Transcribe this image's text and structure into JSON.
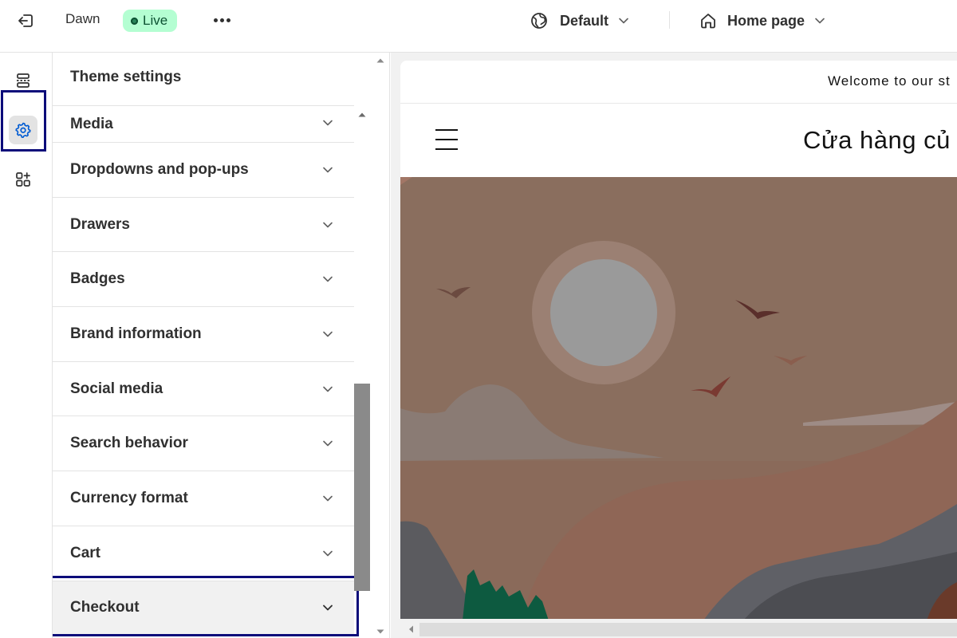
{
  "topbar": {
    "theme_name": "Dawn",
    "status_badge": "Live",
    "market_label": "Default",
    "page_label": "Home page"
  },
  "rail": {
    "items": [
      {
        "name": "sections",
        "icon": "sections-icon",
        "active": false
      },
      {
        "name": "theme-settings",
        "icon": "gear-icon",
        "active": true
      },
      {
        "name": "app-embeds",
        "icon": "apps-add-icon",
        "active": false
      }
    ]
  },
  "panel": {
    "title": "Theme settings",
    "items": [
      {
        "label": "Media"
      },
      {
        "label": "Dropdowns and pop-ups"
      },
      {
        "label": "Drawers"
      },
      {
        "label": "Badges"
      },
      {
        "label": "Brand information"
      },
      {
        "label": "Social media"
      },
      {
        "label": "Search behavior"
      },
      {
        "label": "Currency format"
      },
      {
        "label": "Cart"
      },
      {
        "label": "Checkout",
        "selected": true
      }
    ]
  },
  "preview": {
    "announcement": "Welcome to our st",
    "store_name": "Cửa hàng củ"
  },
  "colors": {
    "accent": "#005bd3",
    "highlight_border": "#0c0c7a",
    "live_badge_bg": "#b4fed2",
    "hero_sky": "#8a6e5e"
  }
}
